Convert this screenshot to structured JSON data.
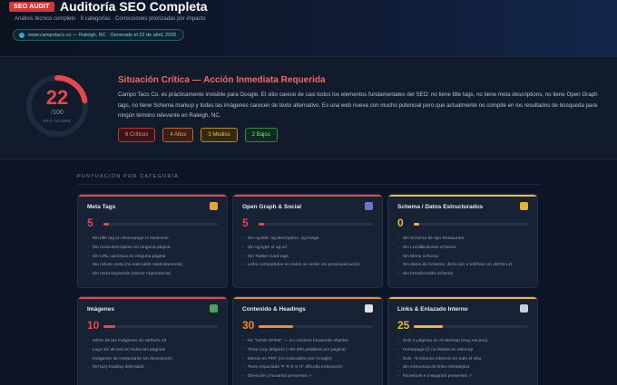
{
  "header": {
    "badge": "SEO AUDIT",
    "title": "Auditoría SEO Completa",
    "subtitle": "Análisis técnico completo · 8 categorías · Correcciones priorizadas por impacto",
    "url_info": "www.campotaco.co — Raleigh, NC · Generado el 22 de abril, 2026"
  },
  "summary": {
    "score": "22",
    "score_max": "/100",
    "score_label": "SEO SCORE",
    "score_fraction": 0.22,
    "situation_title": "Situación Crítica — Acción Inmediata Requerida",
    "situation_text": "Campo Taco Co. es prácticamente invisible para Google. El sitio carece de casi todos los elementos fundamentales del SEO: no tiene title tags, no tiene meta descriptions, no tiene Open Graph tags, no tiene Schema markup y todas las imágenes carecen de texto alternativo. Es una web nueva con mucho potencial pero que actualmente no compite en los resultados de búsqueda para ningún término relevante en Raleigh, NC.",
    "pills": {
      "critical": "6 Críticos",
      "high": "4 Altos",
      "medium": "3 Medios",
      "low": "2 Bajos"
    }
  },
  "categories_heading": "PUNTUACIÓN POR CATEGORÍA",
  "colors": {
    "red": "#e8464a",
    "orange": "#f08a2c",
    "yellow": "#eaba3b"
  },
  "cards": [
    {
      "title": "Meta Tags",
      "icon": "tag-icon",
      "score": "5",
      "fraction": 0.05,
      "items": [
        "Sin title tag en /homepage ni /welcome",
        "Sin meta description en ninguna página",
        "Sin URL canónica en ninguna página",
        "Sin robots meta (no indexable explícitamente)",
        "Sin meta keywords (menor importancia)"
      ]
    },
    {
      "title": "Open Graph & Social",
      "icon": "phone-icon",
      "score": "5",
      "fraction": 0.05,
      "items": [
        "Sin og:title, og:description, og:image",
        "Sin og:type ni og:url",
        "Sin Twitter Card tags",
        "Links compartidos en redes se verán sin previsualización"
      ]
    },
    {
      "title": "Schema / Datos Estructurados",
      "icon": "folder-icon",
      "score": "0",
      "fraction": 0.0,
      "items": [
        "Sin Schema de tipo Restaurant",
        "Sin LocalBusiness schema",
        "Sin Menu schema",
        "Sin datos de horarios, dirección o teléfono en JSON-LD",
        "Sin breadcrumbs schema"
      ]
    },
    {
      "title": "Imágenes",
      "icon": "image-icon",
      "score": "10",
      "fraction": 0.1,
      "items": [
        "100% de las imágenes sin atributo alt",
        "Logo sin alt text en todas las páginas",
        "Imágenes de restaurante sin descripción",
        "Sin lazy loading detectado"
      ]
    },
    {
      "title": "Contenido & Headings",
      "icon": "document-icon",
      "score": "30",
      "fraction": 0.3,
      "items": [
        "H1 \"NOW OPEN\" — no contiene keywords objetivo",
        "Texto muy delgado (~60-200 palabras por página)",
        "Menús en PDF (no indexables por Google)",
        "Texto espaciado \"F R E S H\" dificulta indexación",
        "Dirección y horarios presentes ✓"
      ]
    },
    {
      "title": "Links & Enlazado Interno",
      "icon": "link-icon",
      "score": "25",
      "fraction": 0.25,
      "items": [
        "Solo 2 páginas en el sitemap (muy escaso)",
        "Homepage (/) no listada en sitemap",
        "Solo ~5 enlaces internos en todo el sitio",
        "Sin estructura de links estratégica",
        "Facebook e Instagram presentes ✓"
      ]
    }
  ]
}
